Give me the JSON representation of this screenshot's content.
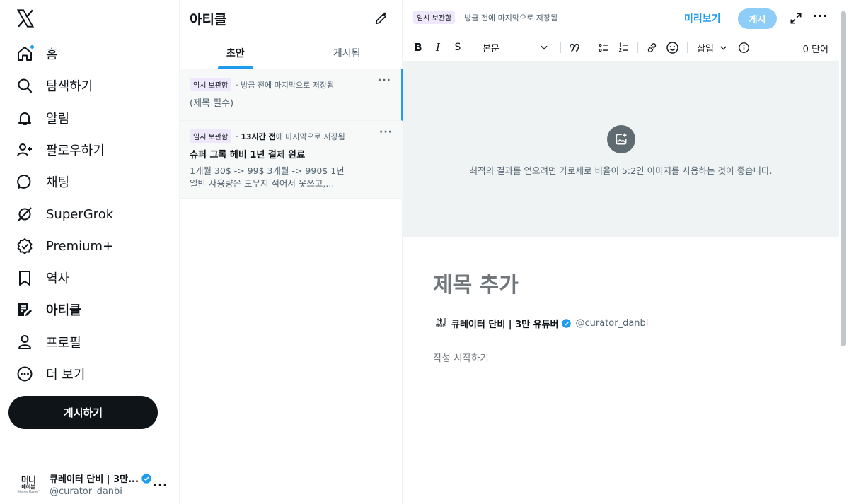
{
  "nav": {
    "items": [
      {
        "label": "홈",
        "icon": "home-icon",
        "notification_dot": true
      },
      {
        "label": "탐색하기",
        "icon": "search-icon"
      },
      {
        "label": "알림",
        "icon": "bell-icon"
      },
      {
        "label": "팔로우하기",
        "icon": "follow-icon"
      },
      {
        "label": "채팅",
        "icon": "chat-icon"
      },
      {
        "label": "SuperGrok",
        "icon": "grok-icon"
      },
      {
        "label": "Premium+",
        "icon": "premium-icon"
      },
      {
        "label": "역사",
        "icon": "bookmark-icon"
      },
      {
        "label": "아티클",
        "icon": "article-icon",
        "active": true
      },
      {
        "label": "프로필",
        "icon": "profile-icon"
      },
      {
        "label": "더 보기",
        "icon": "more-circle-icon"
      }
    ],
    "post_button": "게시하기"
  },
  "account": {
    "avatar_line1": "머니",
    "avatar_line2": "메이븐",
    "avatar_line3": "\"Money Maven\"",
    "name": "큐레이터 단비 | 3만...",
    "handle": "@curator_danbi"
  },
  "articles_panel": {
    "title": "아티클",
    "tabs": [
      "초안",
      "게시됨"
    ],
    "active_tab": 0,
    "drafts": [
      {
        "badge": "임시 보관함",
        "meta_prefix": "· ",
        "meta_bold": "",
        "meta_rest": "방금 전에 마지막으로 저장됨",
        "title": "(제목 필수)",
        "body_line1": "",
        "body_line2": ""
      },
      {
        "badge": "임시 보관함",
        "meta_prefix": "· ",
        "meta_bold": "13시간 전",
        "meta_rest": "에 마지막으로 저장됨",
        "title": "슈퍼 그록 헤비 1년 결제 완료",
        "body_line1": "1개월 30$ -> 99$ 3개월 -> 990$ 1년",
        "body_line2": "일반 사용량은 도무지 적어서 못쓰고,..."
      }
    ]
  },
  "editor": {
    "badge": "임시 보관함",
    "save_status": "· 방금 전에 마지막으로 저장됨",
    "preview": "미리보기",
    "publish": "게시",
    "toolbar": {
      "bold": "B",
      "italic": "I",
      "strike": "S",
      "text_style": "본문",
      "insert": "삽입",
      "word_count": "0 단어"
    },
    "cover_hint": "최적의 결과를 얻으려면 가로세로 비율이 5:2인 이미지를 사용하는 것이 좋습니다.",
    "title_placeholder": "제목 추가",
    "author_name": "큐레이터 단비 | 3만 유튜버",
    "author_handle": "@curator_danbi",
    "body_placeholder": "작성 시작하기",
    "colors": {
      "accent": "#1d9bf0",
      "publish_disabled": "#8ecdf8",
      "badge_bg": "#efe8fd"
    }
  }
}
